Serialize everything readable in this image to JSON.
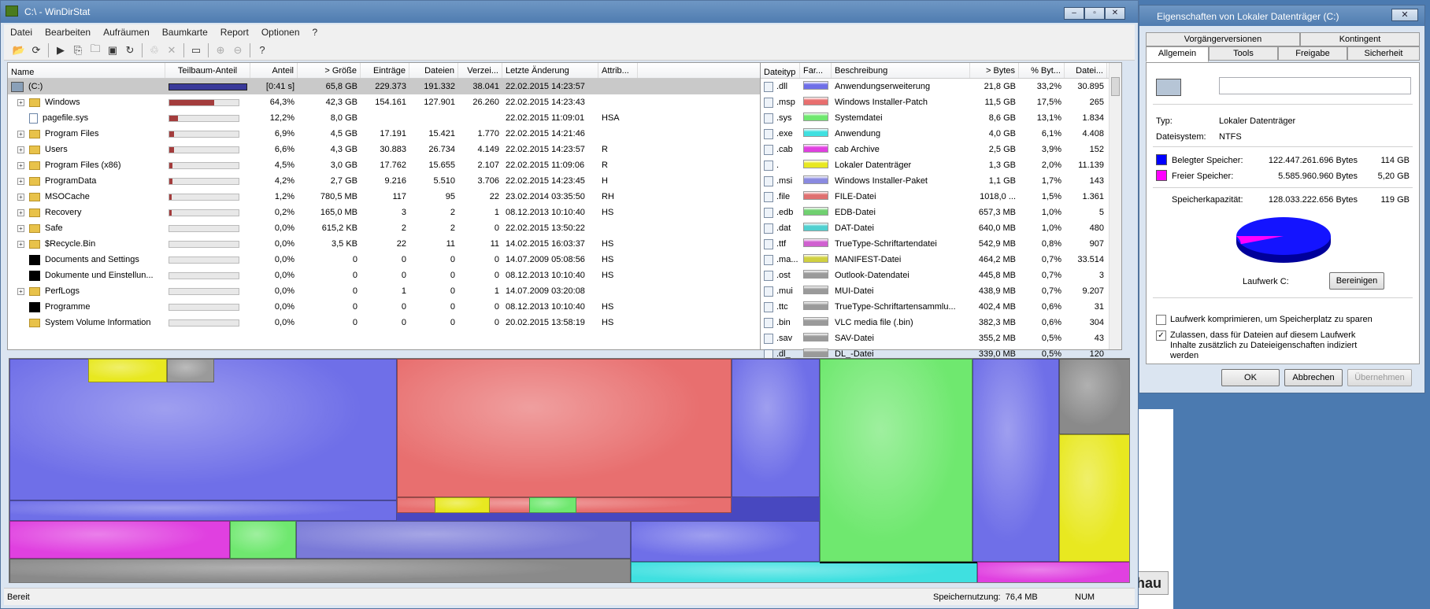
{
  "main_window": {
    "title": "C:\\ - WinDirStat",
    "min": "–",
    "max": "▫",
    "close": "✕"
  },
  "menu": [
    "Datei",
    "Bearbeiten",
    "Aufräumen",
    "Baumkarte",
    "Report",
    "Optionen",
    "?"
  ],
  "tree": {
    "headers": [
      "Name",
      "Teilbaum-Anteil",
      "Anteil",
      "> Größe",
      "Einträge",
      "Dateien",
      "Verzei...",
      "Letzte Änderung",
      "Attrib..."
    ],
    "rows": [
      {
        "name": "(C:)",
        "sub": "",
        "pct": "[0:41 s]",
        "size": "65,8 GB",
        "entries": "229.373",
        "files": "191.332",
        "dirs": "38.041",
        "date": "22.02.2015  14:23:57",
        "attr": "",
        "icon": "drive",
        "exp": "",
        "bar": 1.0,
        "root": true
      },
      {
        "name": "Windows",
        "pct": "64,3%",
        "size": "42,3 GB",
        "entries": "154.161",
        "files": "127.901",
        "dirs": "26.260",
        "date": "22.02.2015  14:23:43",
        "attr": "",
        "icon": "folder",
        "exp": "+",
        "bar": 0.643
      },
      {
        "name": "pagefile.sys",
        "pct": "12,2%",
        "size": "8,0 GB",
        "entries": "",
        "files": "",
        "dirs": "",
        "date": "22.02.2015  11:09:01",
        "attr": "HSA",
        "icon": "file",
        "exp": "",
        "bar": 0.122
      },
      {
        "name": "Program Files",
        "pct": "6,9%",
        "size": "4,5 GB",
        "entries": "17.191",
        "files": "15.421",
        "dirs": "1.770",
        "date": "22.02.2015  14:21:46",
        "attr": "",
        "icon": "folder",
        "exp": "+",
        "bar": 0.069
      },
      {
        "name": "Users",
        "pct": "6,6%",
        "size": "4,3 GB",
        "entries": "30.883",
        "files": "26.734",
        "dirs": "4.149",
        "date": "22.02.2015  14:23:57",
        "attr": "R",
        "icon": "folder",
        "exp": "+",
        "bar": 0.066
      },
      {
        "name": "Program Files (x86)",
        "pct": "4,5%",
        "size": "3,0 GB",
        "entries": "17.762",
        "files": "15.655",
        "dirs": "2.107",
        "date": "22.02.2015  11:09:06",
        "attr": "R",
        "icon": "folder",
        "exp": "+",
        "bar": 0.045
      },
      {
        "name": "ProgramData",
        "pct": "4,2%",
        "size": "2,7 GB",
        "entries": "9.216",
        "files": "5.510",
        "dirs": "3.706",
        "date": "22.02.2015  14:23:45",
        "attr": "H",
        "icon": "folder",
        "exp": "+",
        "bar": 0.042
      },
      {
        "name": "MSOCache",
        "pct": "1,2%",
        "size": "780,5 MB",
        "entries": "117",
        "files": "95",
        "dirs": "22",
        "date": "23.02.2014  03:35:50",
        "attr": "RH",
        "icon": "folder",
        "exp": "+",
        "bar": 0.012
      },
      {
        "name": "Recovery",
        "pct": "0,2%",
        "size": "165,0 MB",
        "entries": "3",
        "files": "2",
        "dirs": "1",
        "date": "08.12.2013  10:10:40",
        "attr": "HS",
        "icon": "folder",
        "exp": "+",
        "bar": 0.002
      },
      {
        "name": "Safe",
        "pct": "0,0%",
        "size": "615,2 KB",
        "entries": "2",
        "files": "2",
        "dirs": "0",
        "date": "22.02.2015  13:50:22",
        "attr": "",
        "icon": "folder",
        "exp": "+",
        "bar": 0
      },
      {
        "name": "$Recycle.Bin",
        "pct": "0,0%",
        "size": "3,5 KB",
        "entries": "22",
        "files": "11",
        "dirs": "11",
        "date": "14.02.2015  16:03:37",
        "attr": "HS",
        "icon": "folder",
        "exp": "+",
        "bar": 0
      },
      {
        "name": "Documents and Settings",
        "pct": "0,0%",
        "size": "0",
        "entries": "0",
        "files": "0",
        "dirs": "0",
        "date": "14.07.2009  05:08:56",
        "attr": "HS",
        "icon": "black",
        "exp": "",
        "bar": 0
      },
      {
        "name": "Dokumente und Einstellun...",
        "pct": "0,0%",
        "size": "0",
        "entries": "0",
        "files": "0",
        "dirs": "0",
        "date": "08.12.2013  10:10:40",
        "attr": "HS",
        "icon": "black",
        "exp": "",
        "bar": 0
      },
      {
        "name": "PerfLogs",
        "pct": "0,0%",
        "size": "0",
        "entries": "1",
        "files": "0",
        "dirs": "1",
        "date": "14.07.2009  03:20:08",
        "attr": "",
        "icon": "folder",
        "exp": "+",
        "bar": 0
      },
      {
        "name": "Programme",
        "pct": "0,0%",
        "size": "0",
        "entries": "0",
        "files": "0",
        "dirs": "0",
        "date": "08.12.2013  10:10:40",
        "attr": "HS",
        "icon": "black",
        "exp": "",
        "bar": 0
      },
      {
        "name": "System Volume Information",
        "pct": "0,0%",
        "size": "0",
        "entries": "0",
        "files": "0",
        "dirs": "0",
        "date": "20.02.2015  13:58:19",
        "attr": "HS",
        "icon": "folder",
        "exp": "",
        "bar": 0
      }
    ]
  },
  "ext": {
    "headers": [
      "Dateityp",
      "Far...",
      "Beschreibung",
      "> Bytes",
      "% Byt...",
      "Datei..."
    ],
    "rows": [
      {
        "ext": ".dll",
        "color": "#6f6fe8",
        "desc": "Anwendungserweiterung",
        "bytes": "21,8 GB",
        "pct": "33,2%",
        "files": "30.895"
      },
      {
        "ext": ".msp",
        "color": "#e86f6f",
        "desc": "Windows Installer-Patch",
        "bytes": "11,5 GB",
        "pct": "17,5%",
        "files": "265"
      },
      {
        "ext": ".sys",
        "color": "#6fe86f",
        "desc": "Systemdatei",
        "bytes": "8,6 GB",
        "pct": "13,1%",
        "files": "1.834"
      },
      {
        "ext": ".exe",
        "color": "#3fe0e0",
        "desc": "Anwendung",
        "bytes": "4,0 GB",
        "pct": "6,1%",
        "files": "4.408"
      },
      {
        "ext": ".cab",
        "color": "#e040e0",
        "desc": "cab Archive",
        "bytes": "2,5 GB",
        "pct": "3,9%",
        "files": "152"
      },
      {
        "ext": ".",
        "color": "#e8e820",
        "desc": "Lokaler Datenträger",
        "bytes": "1,3 GB",
        "pct": "2,0%",
        "files": "11.139"
      },
      {
        "ext": ".msi",
        "color": "#8a8ae0",
        "desc": "Windows Installer-Paket",
        "bytes": "1,1 GB",
        "pct": "1,7%",
        "files": "143"
      },
      {
        "ext": ".file",
        "color": "#e07070",
        "desc": "FILE-Datei",
        "bytes": "1018,0 ...",
        "pct": "1,5%",
        "files": "1.361"
      },
      {
        "ext": ".edb",
        "color": "#70d070",
        "desc": "EDB-Datei",
        "bytes": "657,3 MB",
        "pct": "1,0%",
        "files": "5"
      },
      {
        "ext": ".dat",
        "color": "#50d0d0",
        "desc": "DAT-Datei",
        "bytes": "640,0 MB",
        "pct": "1,0%",
        "files": "480"
      },
      {
        "ext": ".ttf",
        "color": "#d060d0",
        "desc": "TrueType-Schriftartendatei",
        "bytes": "542,9 MB",
        "pct": "0,8%",
        "files": "907"
      },
      {
        "ext": ".ma...",
        "color": "#d0d040",
        "desc": "MANIFEST-Datei",
        "bytes": "464,2 MB",
        "pct": "0,7%",
        "files": "33.514"
      },
      {
        "ext": ".ost",
        "color": "#9a9a9a",
        "desc": "Outlook-Datendatei",
        "bytes": "445,8 MB",
        "pct": "0,7%",
        "files": "3"
      },
      {
        "ext": ".mui",
        "color": "#9a9a9a",
        "desc": "MUI-Datei",
        "bytes": "438,9 MB",
        "pct": "0,7%",
        "files": "9.207"
      },
      {
        "ext": ".ttc",
        "color": "#9a9a9a",
        "desc": "TrueType-Schriftartensammlu...",
        "bytes": "402,4 MB",
        "pct": "0,6%",
        "files": "31"
      },
      {
        "ext": ".bin",
        "color": "#9a9a9a",
        "desc": "VLC media file (.bin)",
        "bytes": "382,3 MB",
        "pct": "0,6%",
        "files": "304"
      },
      {
        "ext": ".sav",
        "color": "#9a9a9a",
        "desc": "SAV-Datei",
        "bytes": "355,2 MB",
        "pct": "0,5%",
        "files": "43"
      },
      {
        "ext": ".dl_",
        "color": "#9a9a9a",
        "desc": "DL_-Datei",
        "bytes": "339,0 MB",
        "pct": "0,5%",
        "files": "120"
      }
    ]
  },
  "status": {
    "ready": "Bereit",
    "mem": "Speichernutzung:",
    "mem_val": "76,4 MB",
    "num": "NUM"
  },
  "bg_button": "hau",
  "dialog": {
    "title": "Eigenschaften von Lokaler Datenträger (C:)",
    "close": "✕",
    "tabs_row1": [
      "Vorgängerversionen",
      "Kontingent"
    ],
    "tabs_row2": [
      "Allgemein",
      "Tools",
      "Freigabe",
      "Sicherheit"
    ],
    "type_label": "Typ:",
    "type_val": "Lokaler Datenträger",
    "fs_label": "Dateisystem:",
    "fs_val": "NTFS",
    "used_label": "Belegter Speicher:",
    "used_bytes": "122.447.261.696 Bytes",
    "used_gb": "114 GB",
    "used_color": "#0000ff",
    "free_label": "Freier Speicher:",
    "free_bytes": "5.585.960.960 Bytes",
    "free_gb": "5,20 GB",
    "free_color": "#ff00ff",
    "cap_label": "Speicherkapazität:",
    "cap_bytes": "128.033.222.656 Bytes",
    "cap_gb": "119 GB",
    "used_fraction": 0.956,
    "drive_label": "Laufwerk C:",
    "cleanup": "Bereinigen",
    "compress": "Laufwerk komprimieren, um Speicherplatz zu sparen",
    "index": "Zulassen, dass für Dateien auf diesem Laufwerk Inhalte zusätzlich zu Dateieigenschaften indiziert werden",
    "ok": "OK",
    "cancel": "Abbrechen",
    "apply": "Übernehmen"
  }
}
